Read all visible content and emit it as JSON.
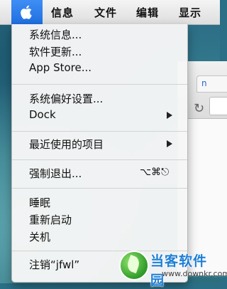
{
  "menubar": {
    "items": [
      {
        "label": "信息"
      },
      {
        "label": "文件"
      },
      {
        "label": "编辑"
      },
      {
        "label": "显示"
      }
    ],
    "accent_color": "#2a7ae8"
  },
  "apple_menu": {
    "items": {
      "about": "系统信息...",
      "update": "软件更新...",
      "store": "App Store...",
      "prefs": "系统偏好设置...",
      "dock": "Dock",
      "recent": "最近使用的项目",
      "force_quit": "强制退出...",
      "force_quit_shortcut": "⌥⌘⎋",
      "sleep": "睡眠",
      "restart": "重新启动",
      "shutdown": "关机",
      "logout": "注销“jfwl”"
    }
  },
  "background_window": {
    "tab_text": "n"
  },
  "watermark": {
    "name": "当客软件园",
    "url": "www.downkr.com"
  }
}
